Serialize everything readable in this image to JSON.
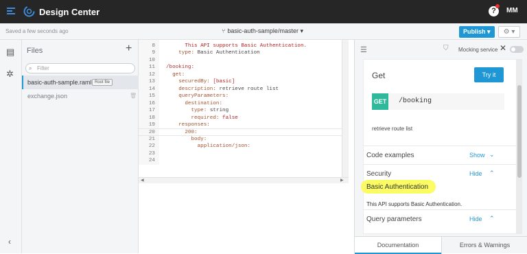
{
  "app": {
    "title": "Design Center",
    "help": "?",
    "user": "MM"
  },
  "subbar": {
    "saved": "Saved a few seconds ago",
    "branch": "basic-auth-sample/master ▾",
    "publish": "Publish ▾",
    "settings": "⚙ ▾"
  },
  "files": {
    "title": "Files",
    "filter_placeholder": "Filter",
    "items": [
      {
        "name": "basic-auth-sample.raml",
        "badge": "Root file"
      },
      {
        "name": "exchange.json"
      }
    ]
  },
  "editor": {
    "lines": [
      {
        "n": "8",
        "parts": [
          [
            "      ",
            "v"
          ],
          [
            "This API supports Basic Authentication.",
            "s"
          ]
        ]
      },
      {
        "n": "9",
        "parts": [
          [
            "    ",
            "v"
          ],
          [
            "type:",
            "k"
          ],
          [
            " Basic Authentication",
            "v"
          ]
        ]
      },
      {
        "n": "10",
        "parts": []
      },
      {
        "n": "11",
        "parts": [
          [
            "/booking:",
            "p"
          ]
        ]
      },
      {
        "n": "12",
        "parts": [
          [
            "  ",
            "v"
          ],
          [
            "get:",
            "k"
          ]
        ]
      },
      {
        "n": "13",
        "parts": [
          [
            "    ",
            "v"
          ],
          [
            "securedBy:",
            "k"
          ],
          [
            " [basic]",
            "s"
          ]
        ]
      },
      {
        "n": "14",
        "parts": [
          [
            "    ",
            "v"
          ],
          [
            "description:",
            "k"
          ],
          [
            " retrieve route list",
            "v"
          ]
        ]
      },
      {
        "n": "15",
        "parts": [
          [
            "    ",
            "v"
          ],
          [
            "queryParameters:",
            "k"
          ]
        ]
      },
      {
        "n": "16",
        "parts": [
          [
            "      ",
            "v"
          ],
          [
            "destination:",
            "k"
          ]
        ]
      },
      {
        "n": "17",
        "parts": [
          [
            "        ",
            "v"
          ],
          [
            "type:",
            "k"
          ],
          [
            " string",
            "v"
          ]
        ]
      },
      {
        "n": "18",
        "parts": [
          [
            "        ",
            "v"
          ],
          [
            "required:",
            "k"
          ],
          [
            " false",
            "s"
          ]
        ]
      },
      {
        "n": "19",
        "parts": [
          [
            "    ",
            "v"
          ],
          [
            "responses:",
            "k"
          ]
        ]
      },
      {
        "n": "20",
        "parts": [
          [
            "      ",
            "v"
          ],
          [
            "200:",
            "k"
          ]
        ]
      },
      {
        "n": "21",
        "parts": [
          [
            "        ",
            "v"
          ],
          [
            "body:",
            "k"
          ]
        ]
      },
      {
        "n": "22",
        "parts": [
          [
            "          ",
            "v"
          ],
          [
            "application/json:",
            "k"
          ]
        ]
      },
      {
        "n": "23",
        "parts": []
      },
      {
        "n": "24",
        "parts": []
      }
    ]
  },
  "doc": {
    "mocking": "Mocking service",
    "method_title": "Get",
    "try_it": "Try it",
    "method": "GET",
    "path": "/booking",
    "description": "retrieve route list",
    "sections": [
      {
        "title": "Code examples",
        "action": "Show",
        "chevron": "⌄"
      },
      {
        "title": "Security",
        "action": "Hide",
        "chevron": "⌃"
      },
      {
        "title": "Query parameters",
        "action": "Hide",
        "chevron": "⌃"
      }
    ],
    "security_name": "Basic Authentication",
    "security_desc": "This API supports Basic Authentication.",
    "tabs": [
      "Documentation",
      "Errors & Warnings"
    ]
  },
  "colors": {
    "accent": "#1f97d4",
    "get_method": "#2db99a",
    "highlight": "#fbfb63"
  }
}
